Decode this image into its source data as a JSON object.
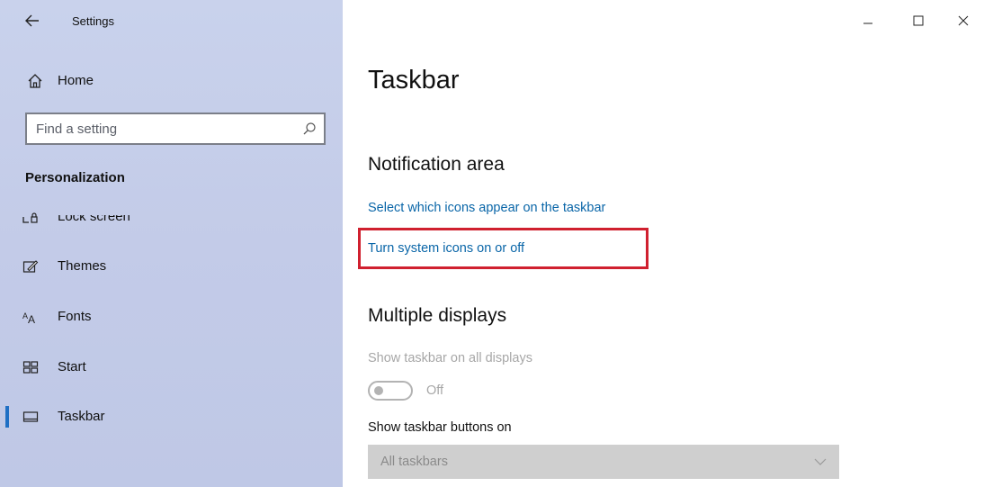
{
  "window": {
    "app_title": "Settings",
    "controls": {
      "minimize": "minimize",
      "maximize": "maximize",
      "close": "close"
    }
  },
  "sidebar": {
    "home_label": "Home",
    "search": {
      "placeholder": "Find a setting",
      "value": ""
    },
    "section_label": "Personalization",
    "items": [
      {
        "label": "Lock screen",
        "icon": "lock-screen-icon"
      },
      {
        "label": "Themes",
        "icon": "themes-icon"
      },
      {
        "label": "Fonts",
        "icon": "fonts-icon"
      },
      {
        "label": "Start",
        "icon": "start-icon"
      },
      {
        "label": "Taskbar",
        "icon": "taskbar-icon",
        "active": true
      }
    ]
  },
  "main": {
    "page_title": "Taskbar",
    "notification_area": {
      "heading": "Notification area",
      "link_select_icons": "Select which icons appear on the taskbar",
      "link_system_icons": "Turn system icons on or off"
    },
    "multiple_displays": {
      "heading": "Multiple displays",
      "show_all_label": "Show taskbar on all displays",
      "toggle_state": "Off",
      "buttons_on_label": "Show taskbar buttons on",
      "buttons_on_value": "All taskbars"
    }
  },
  "colors": {
    "sidebar_bg": "#c5cdea",
    "link": "#0a66a8",
    "highlight": "#d0202f",
    "active_indicator": "#1f6fc4"
  }
}
